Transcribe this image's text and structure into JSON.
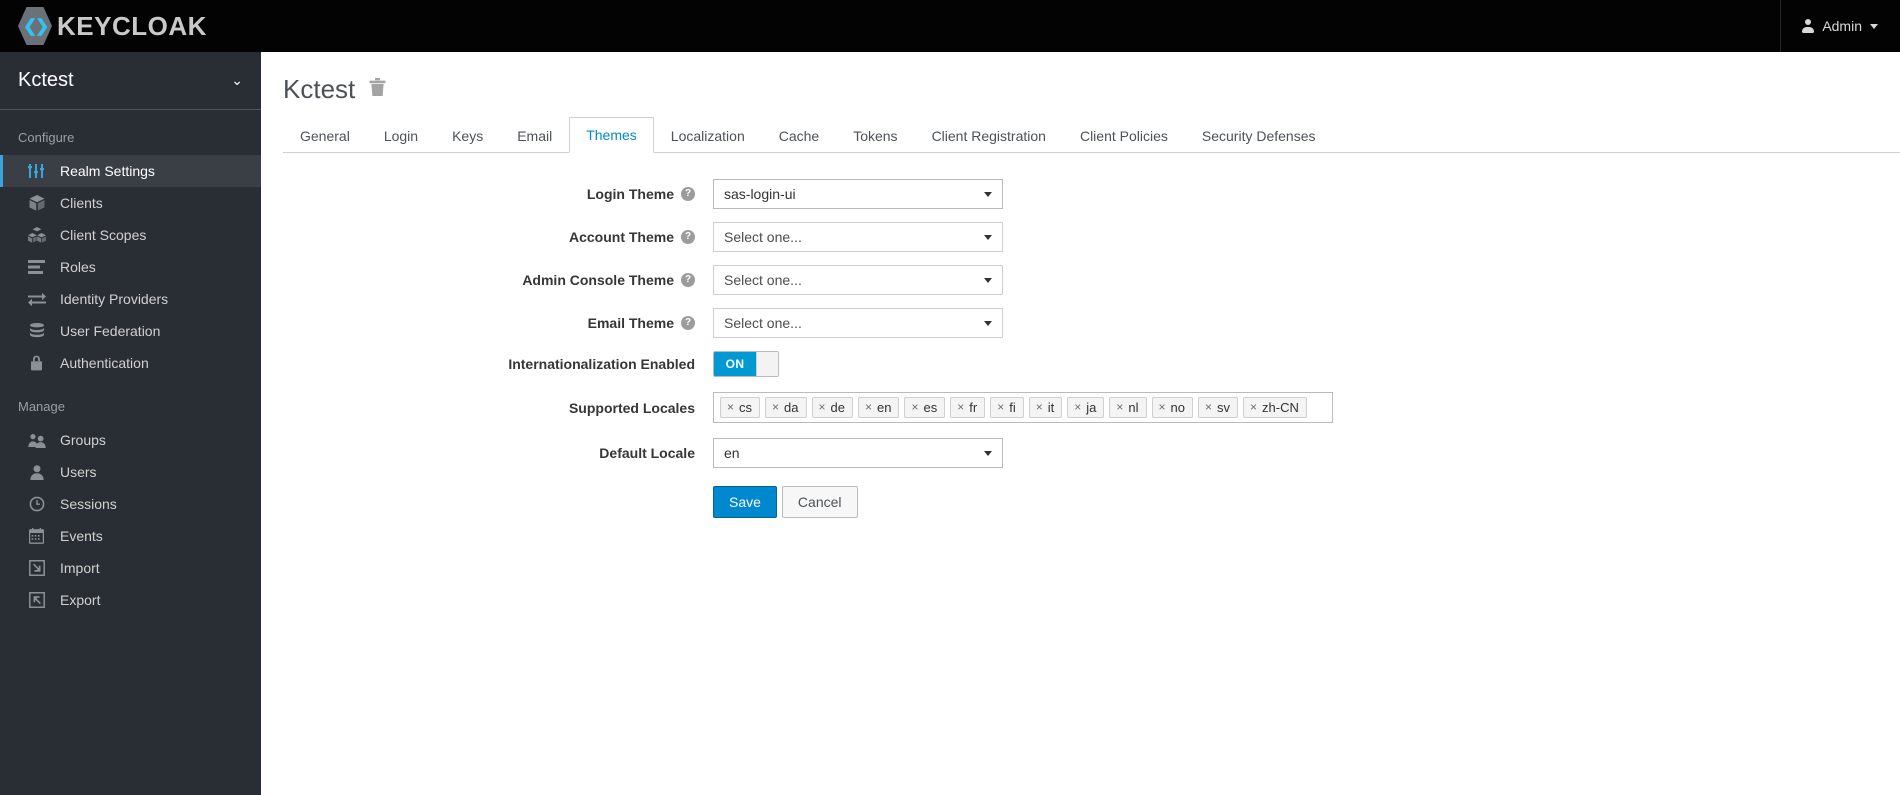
{
  "masthead": {
    "brand": "KEYCLOAK",
    "user": {
      "name": "Admin",
      "icon": "user-icon",
      "caret": "chevron-down-icon"
    }
  },
  "sidebar": {
    "realm": {
      "name": "Kctest",
      "caret": "chevron-down-icon"
    },
    "sections": [
      {
        "title": "Configure",
        "items": [
          {
            "label": "Realm Settings",
            "icon": "sliders-icon",
            "active": true
          },
          {
            "label": "Clients",
            "icon": "box-icon",
            "active": false
          },
          {
            "label": "Client Scopes",
            "icon": "boxes-icon",
            "active": false
          },
          {
            "label": "Roles",
            "icon": "list-icon",
            "active": false
          },
          {
            "label": "Identity Providers",
            "icon": "exchange-arrows-icon",
            "active": false
          },
          {
            "label": "User Federation",
            "icon": "database-icon",
            "active": false
          },
          {
            "label": "Authentication",
            "icon": "lock-icon",
            "active": false
          }
        ]
      },
      {
        "title": "Manage",
        "items": [
          {
            "label": "Groups",
            "icon": "users-group-icon",
            "active": false
          },
          {
            "label": "Users",
            "icon": "user-icon",
            "active": false
          },
          {
            "label": "Sessions",
            "icon": "clock-icon",
            "active": false
          },
          {
            "label": "Events",
            "icon": "calendar-icon",
            "active": false
          },
          {
            "label": "Import",
            "icon": "arrow-into-box-icon",
            "active": false
          },
          {
            "label": "Export",
            "icon": "arrow-out-of-box-icon",
            "active": false
          }
        ]
      }
    ]
  },
  "page": {
    "title": "Kctest",
    "delete_icon": "trash-icon",
    "tabs": [
      {
        "label": "General",
        "active": false
      },
      {
        "label": "Login",
        "active": false
      },
      {
        "label": "Keys",
        "active": false
      },
      {
        "label": "Email",
        "active": false
      },
      {
        "label": "Themes",
        "active": true
      },
      {
        "label": "Localization",
        "active": false
      },
      {
        "label": "Cache",
        "active": false
      },
      {
        "label": "Tokens",
        "active": false
      },
      {
        "label": "Client Registration",
        "active": false
      },
      {
        "label": "Client Policies",
        "active": false
      },
      {
        "label": "Security Defenses",
        "active": false
      }
    ]
  },
  "form": {
    "login_theme": {
      "label": "Login Theme",
      "value": "sas-login-ui",
      "help": "?"
    },
    "account_theme": {
      "label": "Account Theme",
      "value": "Select one...",
      "help": "?"
    },
    "admin_console_theme": {
      "label": "Admin Console Theme",
      "value": "Select one...",
      "help": "?"
    },
    "email_theme": {
      "label": "Email Theme",
      "value": "Select one...",
      "help": "?"
    },
    "internationalization": {
      "label": "Internationalization Enabled",
      "state": "ON"
    },
    "supported_locales": {
      "label": "Supported Locales",
      "chips": [
        "cs",
        "da",
        "de",
        "en",
        "es",
        "fr",
        "fi",
        "it",
        "ja",
        "nl",
        "no",
        "sv",
        "zh-CN"
      ],
      "remove_glyph": "×"
    },
    "default_locale": {
      "label": "Default Locale",
      "value": "en"
    },
    "save_label": "Save",
    "cancel_label": "Cancel"
  },
  "colors": {
    "accent_blue": "#0088ce",
    "toggle_blue": "#0099d3",
    "sidebar_bg": "#292e34",
    "sidebar_active": "#393f44",
    "masthead_bg": "#030303",
    "logo_cyan": "#33c3f0"
  }
}
